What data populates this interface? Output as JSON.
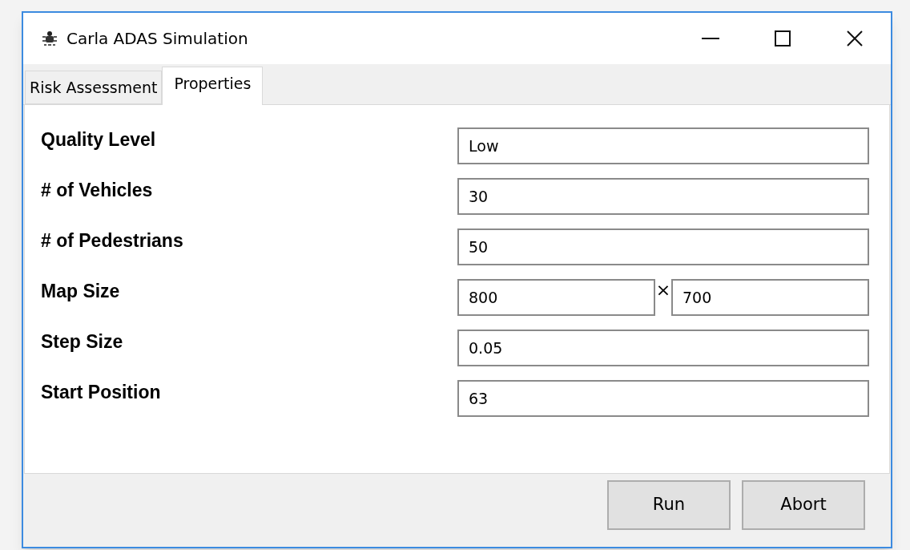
{
  "window": {
    "title": "Carla ADAS Simulation"
  },
  "tabs": [
    {
      "label": "Risk Assessment",
      "selected": false
    },
    {
      "label": "Properties",
      "selected": true
    }
  ],
  "fields": [
    {
      "kind": "single",
      "label": "Quality Level",
      "value": "Low"
    },
    {
      "kind": "single",
      "label": "# of Vehicles",
      "value": "30"
    },
    {
      "kind": "single",
      "label": "# of Pedestrians",
      "value": "50"
    },
    {
      "kind": "pair",
      "label": "Map Size",
      "value": "800",
      "separator": "×",
      "value2": "700"
    },
    {
      "kind": "single",
      "label": "Step Size",
      "value": "0.05"
    },
    {
      "kind": "single",
      "label": "Start Position",
      "value": "63"
    }
  ],
  "buttons": [
    "Run",
    "Abort"
  ]
}
